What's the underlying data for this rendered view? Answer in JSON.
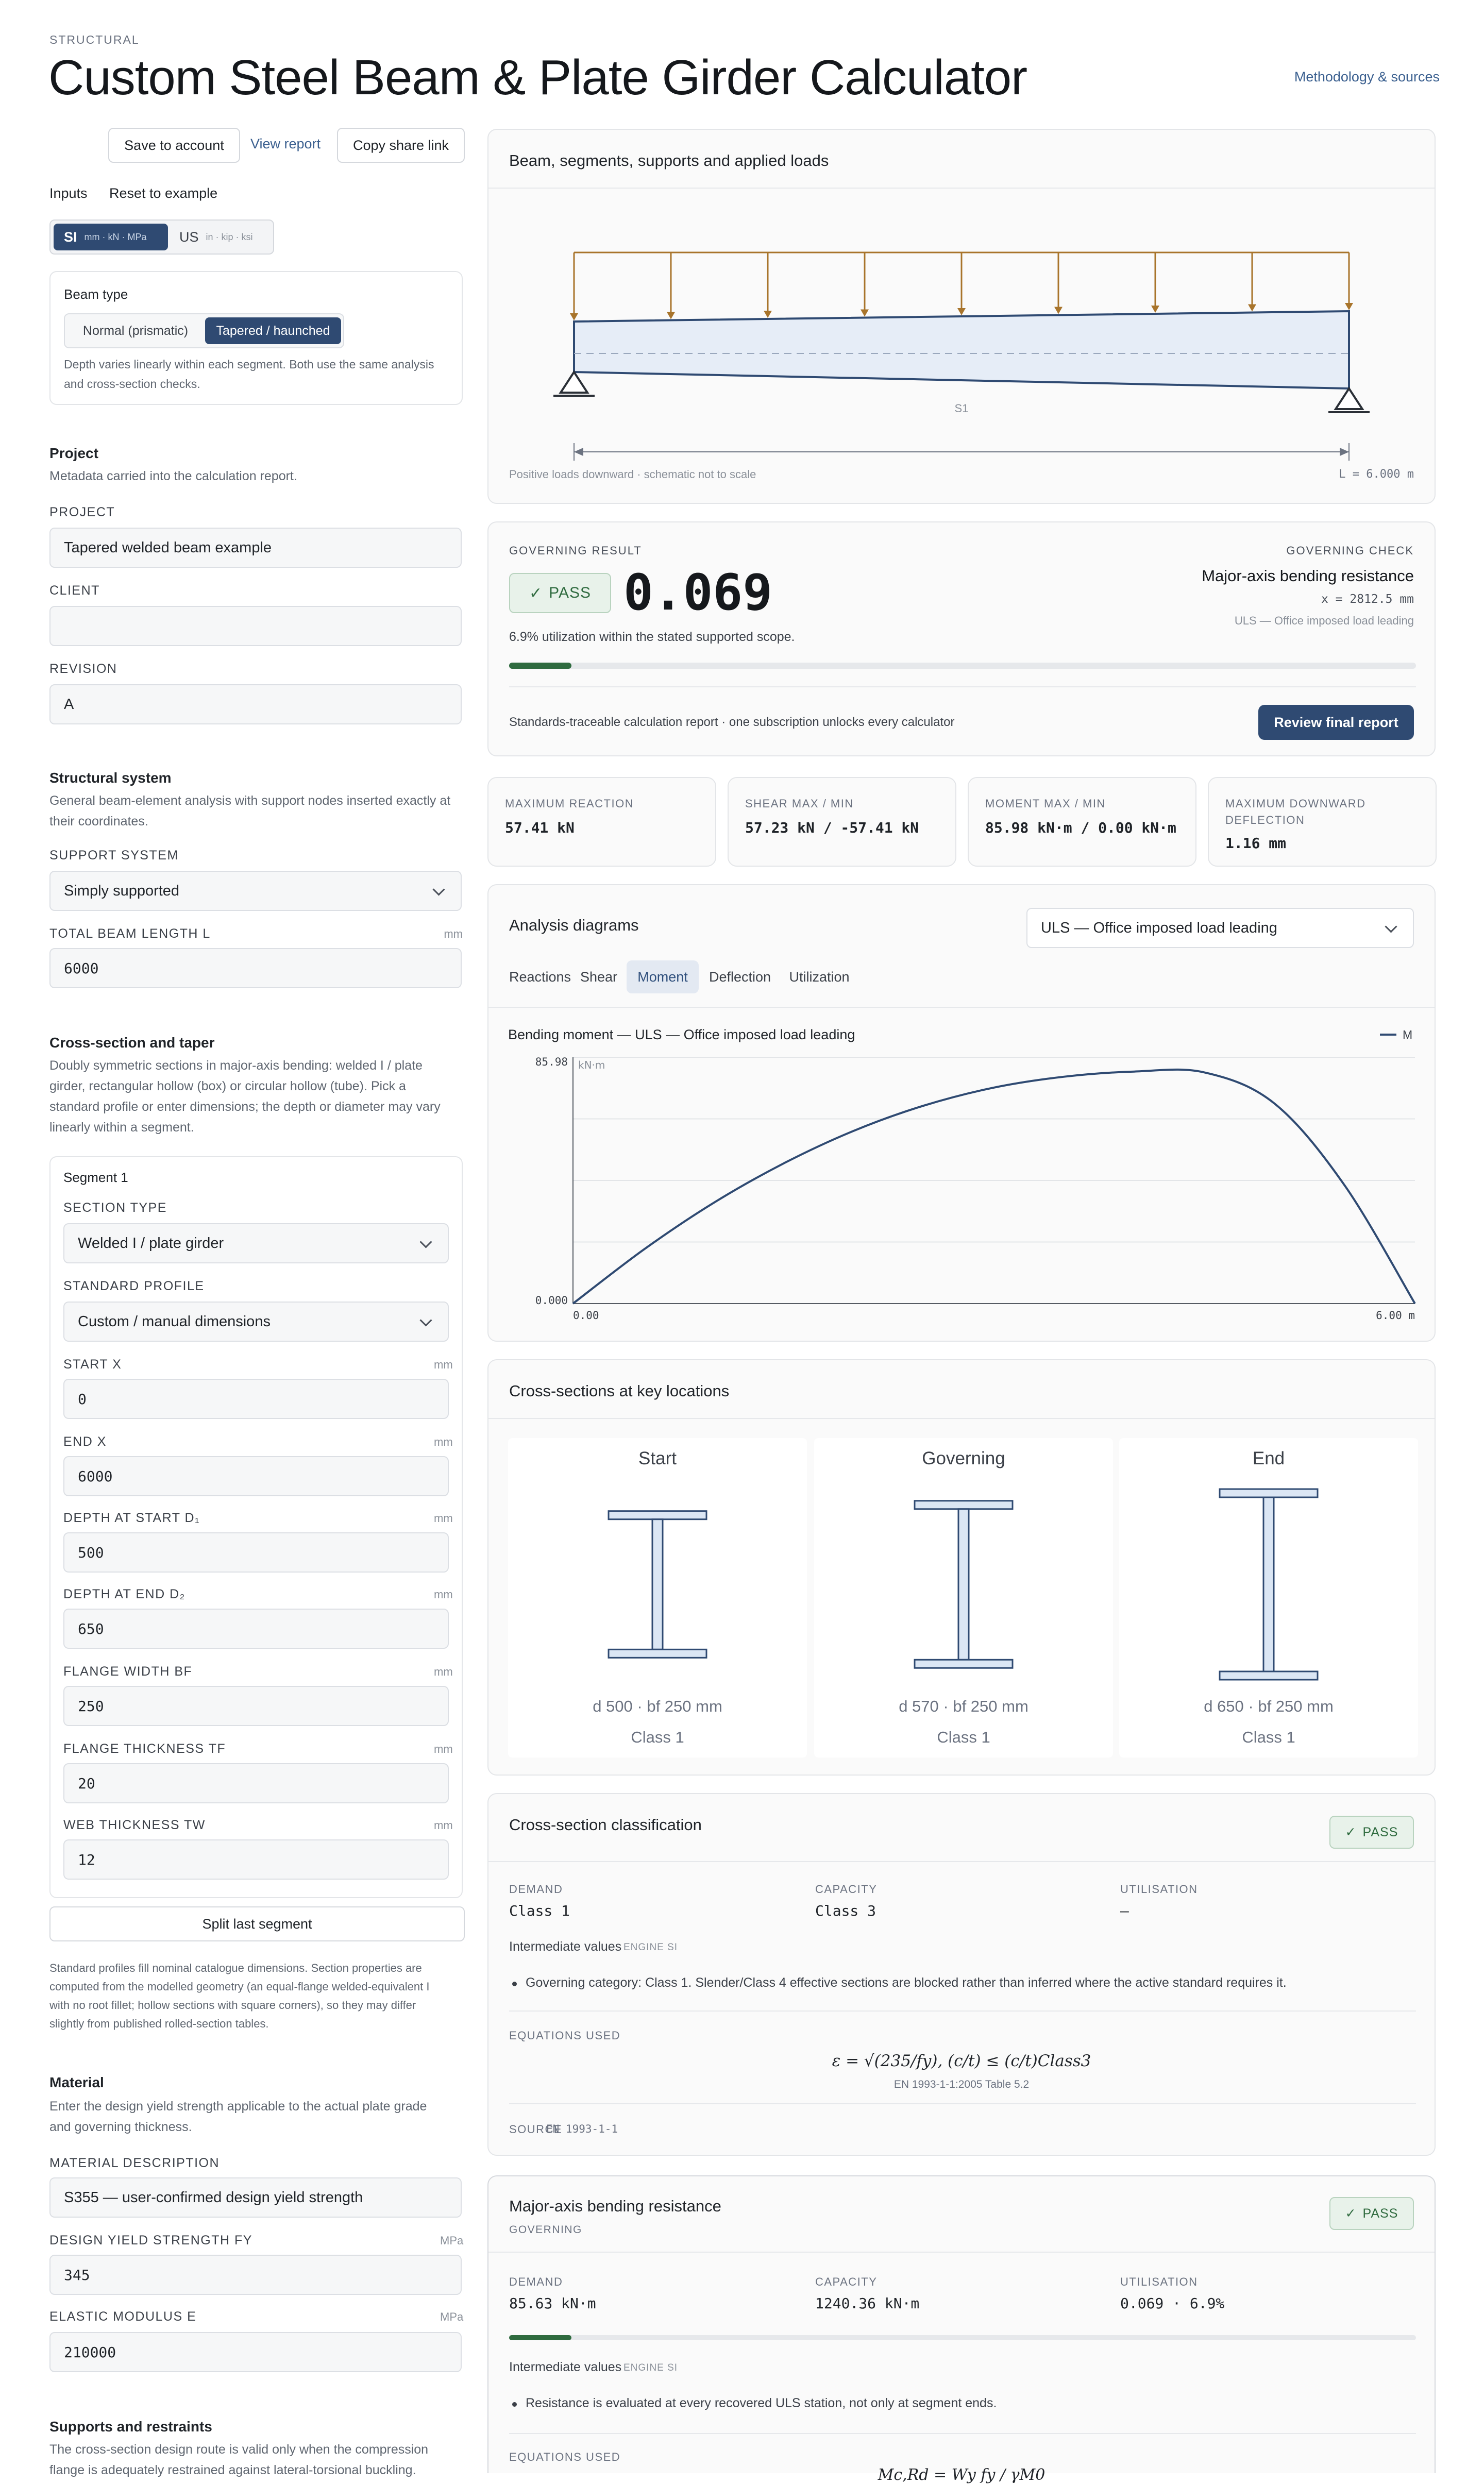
{
  "header": {
    "overline": "STRUCTURAL",
    "title": "Custom Steel Beam & Plate Girder Calculator",
    "methodology_link": "Methodology & sources"
  },
  "actions": {
    "save": "Save to account",
    "view_report": "View report",
    "copy_link": "Copy share link"
  },
  "inputs_bar": {
    "inputs_label": "Inputs",
    "reset": "Reset to example",
    "units": [
      {
        "code": "SI",
        "detail": "mm · kN · MPa",
        "active": true
      },
      {
        "code": "US",
        "detail": "in · kip · ksi",
        "active": false
      }
    ]
  },
  "beam_type": {
    "title": "Beam type",
    "options": [
      "Normal (prismatic)",
      "Tapered / haunched"
    ],
    "selected": "Tapered / haunched",
    "help": [
      "Depth varies linearly within each segment. Both use the same analysis",
      "and cross-section checks."
    ]
  },
  "project": {
    "title": "Project",
    "desc": "Metadata carried into the calculation report.",
    "project_label": "PROJECT",
    "project_value": "Tapered welded beam example",
    "client_label": "CLIENT",
    "client_value": "",
    "revision_label": "REVISION",
    "revision_value": "A"
  },
  "structural_system": {
    "title": "Structural system",
    "desc": [
      "General beam-element analysis with support nodes inserted exactly at",
      "their coordinates."
    ],
    "support_label": "SUPPORT SYSTEM",
    "support_value": "Simply supported",
    "length_label": "TOTAL BEAM LENGTH L",
    "length_unit": "mm",
    "length_value": "6000"
  },
  "cross_section": {
    "title": "Cross-section and taper",
    "desc": [
      "Doubly symmetric sections in major-axis bending: welded I / plate",
      "girder, rectangular hollow (box) or circular hollow (tube). Pick a",
      "standard profile or enter dimensions; the depth or diameter may vary",
      "linearly within a segment."
    ],
    "segment_title": "Segment 1",
    "section_type_label": "SECTION TYPE",
    "section_type_value": "Welded I / plate girder",
    "profile_label": "STANDARD PROFILE",
    "profile_value": "Custom / manual dimensions",
    "start_x_label": "START x",
    "start_x_value": "0",
    "end_x_label": "END x",
    "end_x_value": "6000",
    "depth_start_label": "DEPTH AT START D₁",
    "depth_start_value": "500",
    "depth_end_label": "DEPTH AT END D₂",
    "depth_end_value": "650",
    "flange_width_label": "FLANGE WIDTH BF",
    "flange_width_value": "250",
    "flange_thk_label": "FLANGE THICKNESS TF",
    "flange_thk_value": "20",
    "web_thk_label": "WEB THICKNESS TW",
    "web_thk_value": "12",
    "unit": "mm",
    "split_button": "Split last segment",
    "note": [
      "Standard profiles fill nominal catalogue dimensions. Section properties are",
      "computed from the modelled geometry (an equal-flange welded-equivalent I",
      "with no root fillet; hollow sections with square corners), so they may differ",
      "slightly from published rolled-section tables."
    ]
  },
  "material": {
    "title": "Material",
    "desc": [
      "Enter the design yield strength applicable to the actual plate grade",
      "and governing thickness."
    ],
    "desc_label": "MATERIAL DESCRIPTION",
    "desc_value": "S355 — user-confirmed design yield strength",
    "fy_label": "DESIGN YIELD STRENGTH FY",
    "fy_unit": "MPa",
    "fy_value": "345",
    "e_label": "ELASTIC MODULUS E",
    "e_unit": "MPa",
    "e_value": "210000"
  },
  "supports": {
    "title": "Supports and restraints",
    "desc": [
      "The cross-section design route is valid only when the compression",
      "flange is adequately restrained against lateral-torsional buckling."
    ]
  },
  "schematic": {
    "title": "Beam, segments, supports and applied loads",
    "segment_label": "S1",
    "footnote": "Positive loads downward · schematic not to scale",
    "length_note": "L = 6.000 m"
  },
  "result": {
    "overline": "GOVERNING RESULT",
    "status": "PASS",
    "value": "0.069",
    "utilization_text": "6.9% utilization within the stated supported scope.",
    "utilization_fraction": 0.069,
    "check_overline": "GOVERNING CHECK",
    "check_name": "Major-axis bending resistance",
    "check_location": "x = 2812.5 mm",
    "check_combo": "ULS — Office imposed load leading",
    "promo": "Standards-traceable calculation report · one subscription unlocks every calculator",
    "review_button": "Review final report"
  },
  "stats": [
    {
      "label": "MAXIMUM REACTION",
      "value": "57.41 kN"
    },
    {
      "label": "SHEAR MAX / MIN",
      "value": "57.23 kN / -57.41 kN"
    },
    {
      "label": "MOMENT MAX / MIN",
      "value": "85.98 kN·m / 0.00 kN·m"
    },
    {
      "label_lines": [
        "MAXIMUM DOWNWARD",
        "DEFLECTION"
      ],
      "value": "1.16 mm"
    }
  ],
  "analysis": {
    "title": "Analysis diagrams",
    "combo_select": "ULS — Office imposed load leading",
    "tabs": [
      "Reactions",
      "Shear",
      "Moment",
      "Deflection",
      "Utilization"
    ],
    "active_tab": "Moment",
    "colors": {
      "line": "#2f4a72",
      "load": "#a8742b"
    }
  },
  "chart_data": {
    "type": "line",
    "title": "Bending moment — ULS — Office imposed load leading",
    "ylabel": "kN·m",
    "legend": [
      "M"
    ],
    "xlim": [
      0,
      6
    ],
    "ylim": [
      0,
      85.98
    ],
    "x_tick_labels": [
      "0.00",
      "6.00 m"
    ],
    "y_tick_labels": [
      "85.98",
      "0.000"
    ],
    "series": [
      {
        "name": "M",
        "x": [
          0,
          0.5,
          1,
          1.5,
          2,
          2.5,
          3,
          3.5,
          4,
          4.5,
          5,
          5.5,
          6
        ],
        "y": [
          0,
          18.7,
          35.1,
          48.9,
          60.3,
          69.1,
          75.4,
          79.2,
          81.0,
          80.7,
          69.8,
          41.2,
          0
        ]
      }
    ]
  },
  "sections": {
    "title": "Cross-sections at key locations",
    "items": [
      {
        "title": "Start",
        "dims": "d 500 · bf 250 mm",
        "class": "Class 1",
        "depth_mm": 500
      },
      {
        "title": "Governing",
        "dims": "d 570 · bf 250 mm",
        "class": "Class 1",
        "depth_mm": 570
      },
      {
        "title": "End",
        "dims": "d 650 · bf 250 mm",
        "class": "Class 1",
        "depth_mm": 650
      }
    ]
  },
  "classification": {
    "title": "Cross-section classification",
    "status": "PASS",
    "demand_label": "DEMAND",
    "demand_value": "Class 1",
    "capacity_label": "CAPACITY",
    "capacity_value": "Class 3",
    "util_label": "UTILISATION",
    "util_value": "—",
    "intermediate_label": "Intermediate values",
    "engine_tag": "ENGINE SI",
    "bullet": "Governing category: Class 1. Slender/Class 4 effective sections are blocked rather than inferred where the active standard requires it.",
    "equations_label": "EQUATIONS USED",
    "equation": "ε = √(235/fy),   (c/t) ≤ (c/t)Class3",
    "equation_ref": "EN 1993-1-1:2005 Table 5.2",
    "source_label": "SOURCE",
    "source_value": "EN 1993-1-1"
  },
  "bending": {
    "title": "Major-axis bending resistance",
    "tag": "GOVERNING",
    "status": "PASS",
    "demand_label": "DEMAND",
    "demand_value": "85.63 kN·m",
    "capacity_label": "CAPACITY",
    "capacity_value": "1240.36 kN·m",
    "util_label": "UTILISATION",
    "util_value": "0.069 · 6.9%",
    "utilization_fraction": 0.069,
    "intermediate_label": "Intermediate values",
    "engine_tag": "ENGINE SI",
    "bullet": "Resistance is evaluated at every recovered ULS station, not only at segment ends.",
    "equations_label": "EQUATIONS USED",
    "equation": "Mc,Rd = Wy fy / γM0"
  }
}
